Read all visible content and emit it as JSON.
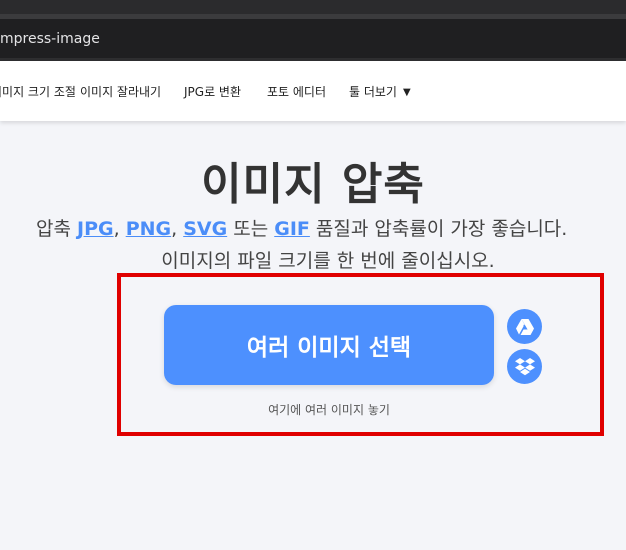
{
  "browser": {
    "url_fragment": "mpress-image"
  },
  "nav": {
    "items": [
      "이미지 크기 조절",
      "이미지 잘라내기",
      "JPG로 변환",
      "포토 에디터",
      "툴 더보기"
    ],
    "caret": "▼"
  },
  "main": {
    "title": "이미지 압축",
    "subtitle_prefix": "압축 ",
    "formats": [
      "JPG",
      "PNG",
      "SVG",
      "GIF"
    ],
    "sep1": ", ",
    "sep2": ", ",
    "sep3": " 또는 ",
    "subtitle_suffix": " 품질과 압축률이 가장 좋습니다.",
    "subtitle_line2": "이미지의 파일 크기를 한 번에 줄이십시오.",
    "select_button": "여러 이미지 선택",
    "drop_hint": "여기에 여러 이미지 놓기"
  },
  "colors": {
    "accent": "#4d90fe",
    "highlight": "#e00000"
  },
  "icons": {
    "google_drive": "google-drive-icon",
    "dropbox": "dropbox-icon"
  }
}
